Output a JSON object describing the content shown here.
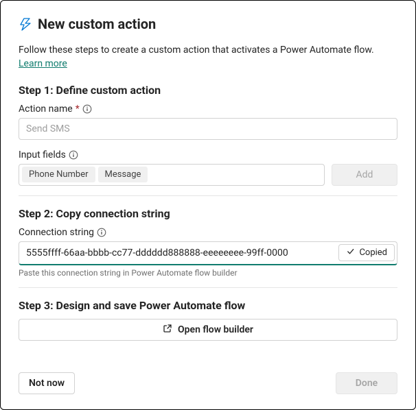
{
  "header": {
    "title": "New custom action"
  },
  "intro": {
    "text": "Follow these steps to create a custom action that activates a Power Automate flow. ",
    "link_label": "Learn more"
  },
  "step1": {
    "title": "Step 1: Define custom action",
    "action_name_label": "Action name",
    "action_name_placeholder": "Send SMS",
    "input_fields_label": "Input fields",
    "chips": [
      "Phone Number",
      "Message"
    ],
    "add_label": "Add"
  },
  "step2": {
    "title": "Step 2: Copy connection string",
    "conn_label": "Connection string",
    "conn_value": "5555ffff-66aa-bbbb-cc77-dddddd888888-eeeeeeee-99ff-0000",
    "copied_label": "Copied",
    "helper": "Paste this connection string in Power Automate flow builder"
  },
  "step3": {
    "title": "Step 3: Design and save Power Automate flow",
    "open_flow_label": "Open flow builder"
  },
  "footer": {
    "not_now": "Not now",
    "done": "Done"
  }
}
